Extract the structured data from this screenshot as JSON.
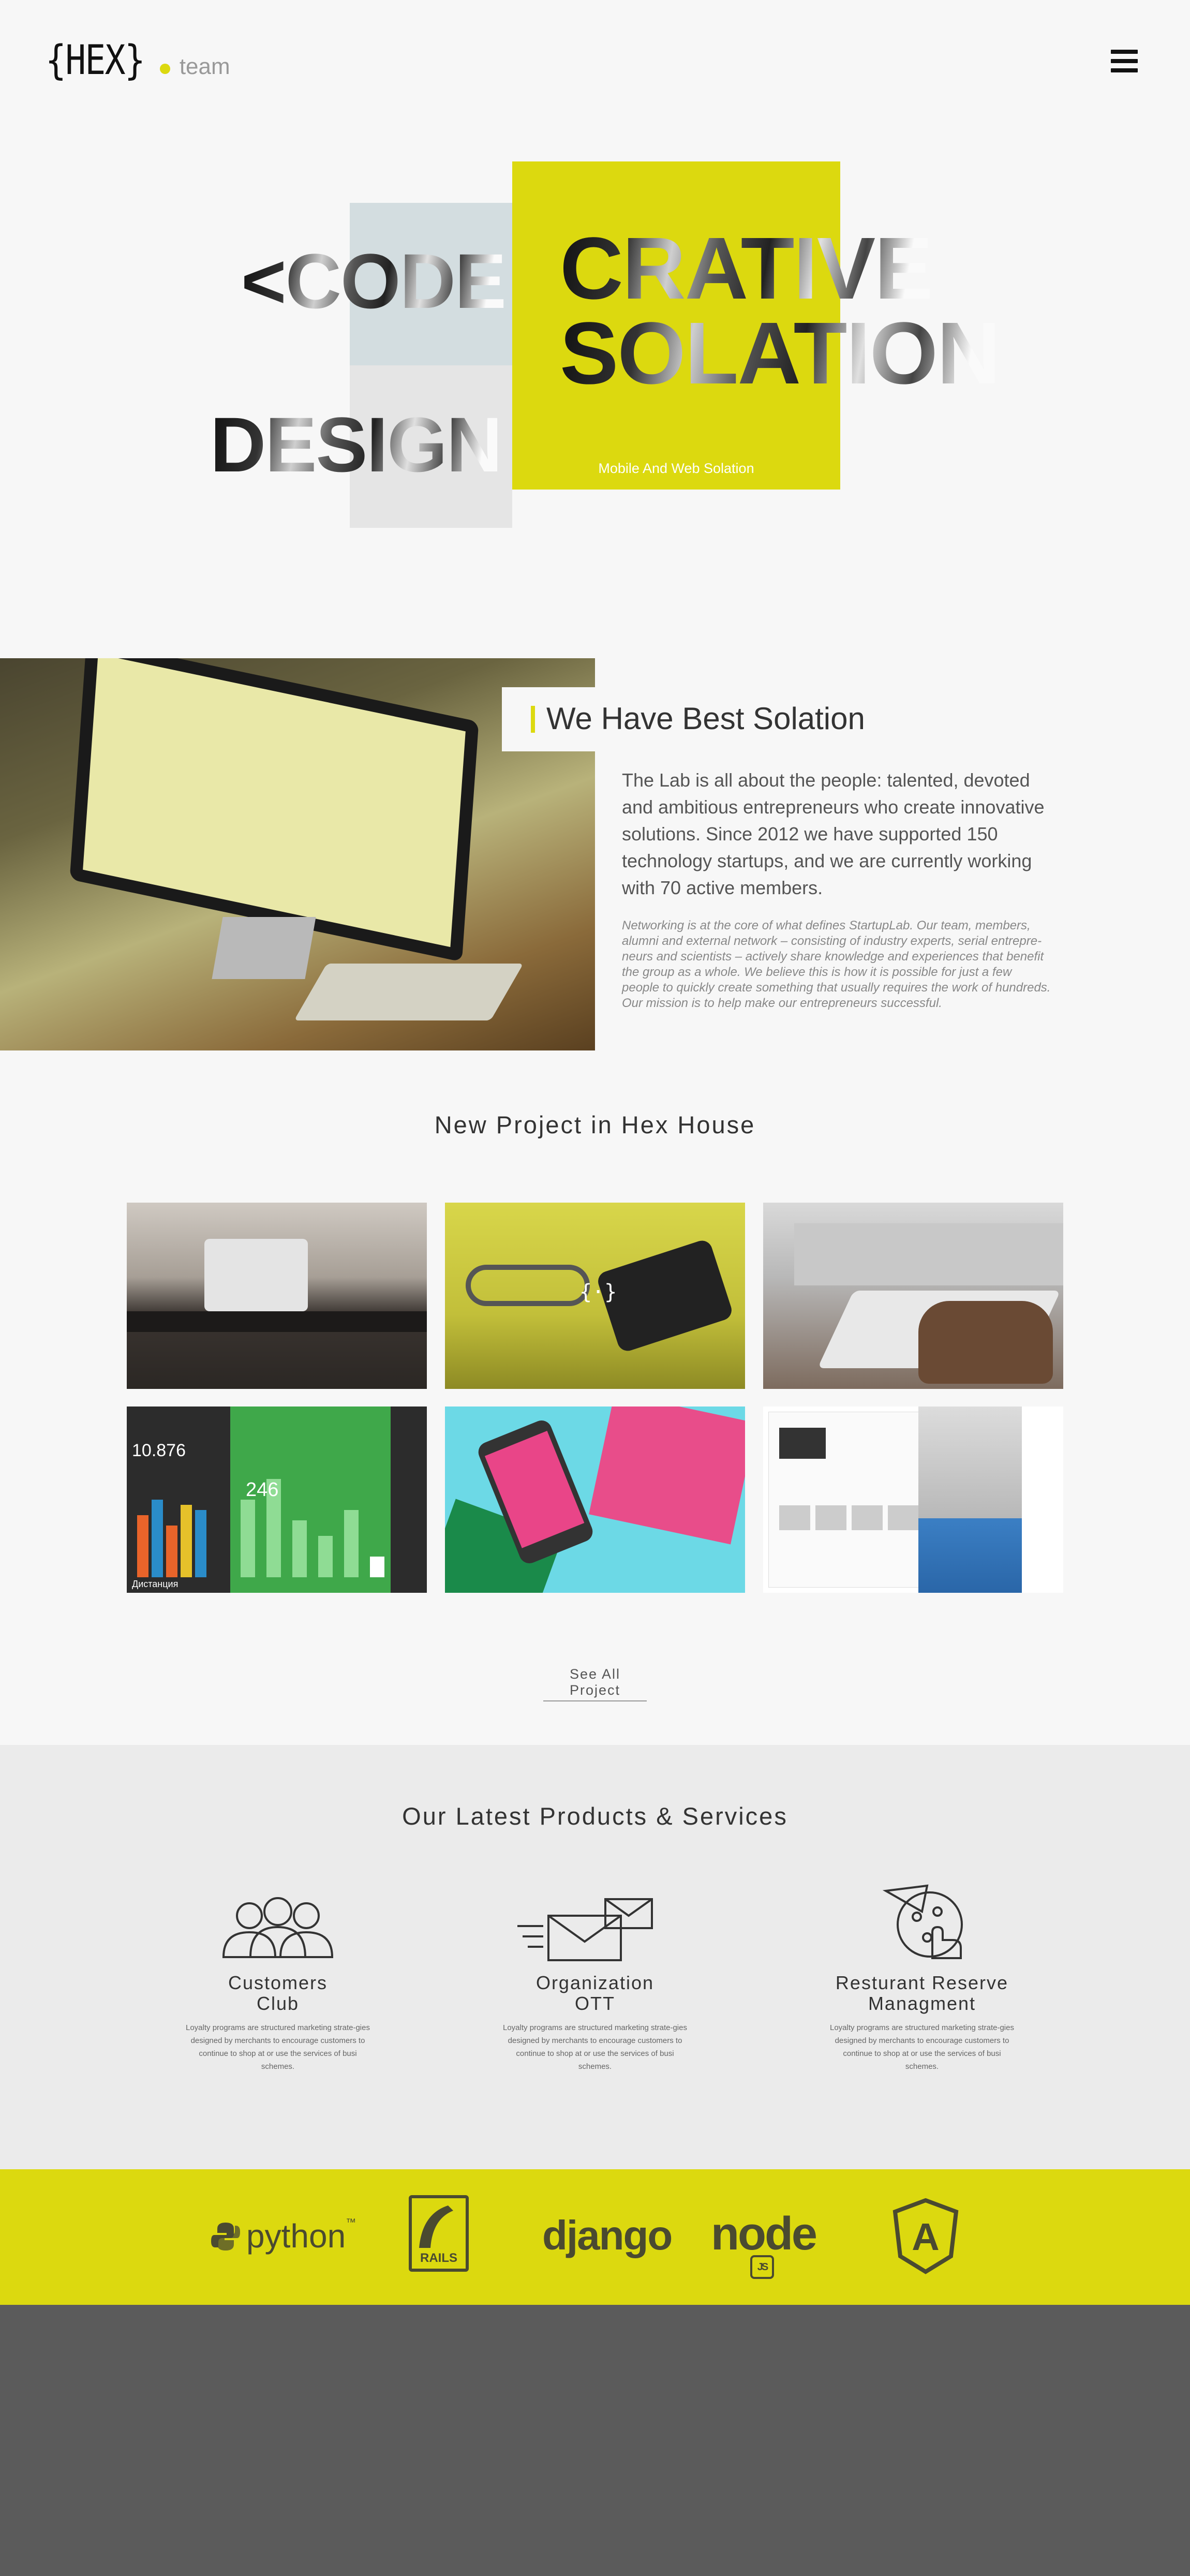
{
  "header": {
    "logo_mark": "{HEX}",
    "logo_team": "team"
  },
  "hero": {
    "word_code": "<CODE",
    "word_design": "DESIGN",
    "word_crative": "CRATIVE",
    "word_solation": "SOLATION",
    "subtitle": "Mobile And Web Solation"
  },
  "about": {
    "title": "We Have Best Solation",
    "lead": "The Lab is all about the people: talented, devoted and ambitious entrepreneurs who create innovative solutions. Since 2012 we have supported 150 technology startups, and we are currently working with 70 active members.",
    "body": "Networking is at the core of what defines StartupLab. Our team, members, alumni and external network – consisting of industry experts, serial entrepre-neurs and scientists – actively share knowledge and experiences that benefit the group as a whole. We believe this is how it is possible for just a few people to quickly create something that usually requires the work of hundreds. Our mission is to help make our entrepreneurs successful."
  },
  "projects": {
    "title": "New Project in Hex House",
    "see_all": "See All Project",
    "app_label": "Дистанция",
    "app_num1": "10.876",
    "app_num2": "246"
  },
  "services": {
    "title": "Our Latest Products & Services",
    "items": [
      {
        "title_line1": "Customers",
        "title_line2": "Club",
        "text": "Loyalty programs are structured marketing strate-gies designed by merchants to encourage customers to continue to shop at or use the services of busi schemes.",
        "icon": "users-icon"
      },
      {
        "title_line1": "Organization",
        "title_line2": "OTT",
        "text": "Loyalty programs are structured marketing strate-gies designed by merchants to encourage customers to continue to shop at or use the services of busi schemes.",
        "icon": "mail-icon"
      },
      {
        "title_line1": "Resturant Reserve",
        "title_line2": "Managment",
        "text": "Loyalty programs are structured marketing strate-gies designed by merchants to encourage customers to continue to shop at or use the services of busi schemes.",
        "icon": "pizza-order-icon"
      }
    ]
  },
  "tech": {
    "python": "python",
    "rails": "RAILS",
    "django": "django",
    "node": "node",
    "node_sub": "JS",
    "angular": "A"
  },
  "colors": {
    "accent": "#dcd90f",
    "footer": "#5b5b5b",
    "services_bg": "#ebebeb"
  }
}
